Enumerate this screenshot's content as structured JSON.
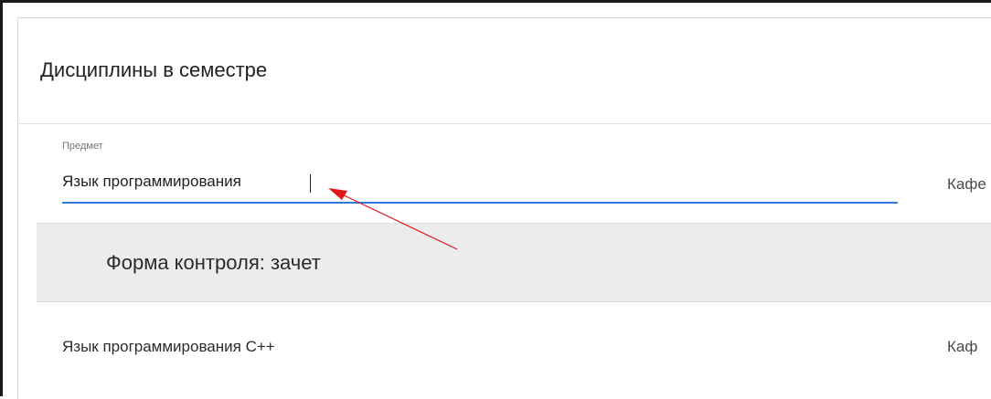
{
  "panel": {
    "title": "Дисциплины в семестре"
  },
  "subject_field": {
    "label": "Предмет",
    "value": "Язык программирования"
  },
  "columns": {
    "department_truncated_1": "Кафе",
    "department_truncated_2": "Каф"
  },
  "control_form": {
    "text": "Форма контроля: зачет"
  },
  "list": {
    "items": [
      {
        "name": "Язык программирования С++"
      }
    ]
  },
  "annotation": {
    "arrow_color": "#e01818"
  },
  "colors": {
    "accent": "#2c7bd6",
    "band": "#ececec"
  }
}
